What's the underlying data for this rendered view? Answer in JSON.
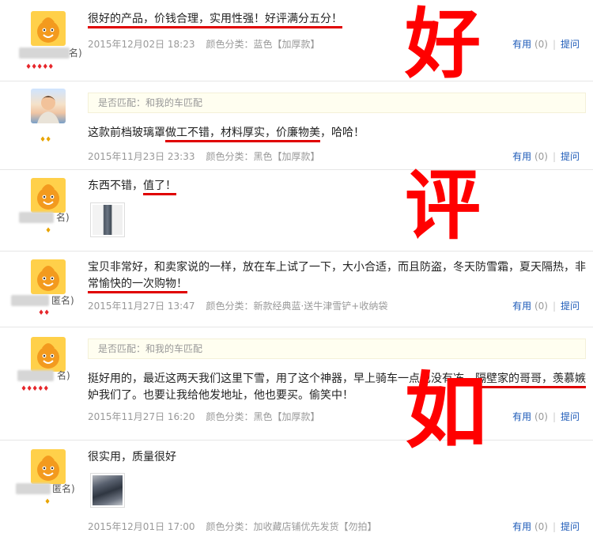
{
  "actions": {
    "useful_label": "有用",
    "useful_count": "(0)",
    "ask_label": "提问"
  },
  "overlay": {
    "c1": "好",
    "c2": "评",
    "c3": "如"
  },
  "reviews": [
    {
      "text_parts": [
        "很好的产品，价钱合理，实用性强！好评满分五分！"
      ],
      "date": "2015年12月02日 18:23",
      "spec": "颜色分类：蓝色【加厚款】",
      "nick_suffix": "名)",
      "gems": "♦♦♦♦♦"
    },
    {
      "match": "是否匹配：和我的车匹配",
      "text_a": "这款前档玻璃罩",
      "text_u1": "做工不错，材料厚实，价廉物美",
      "text_b": "，哈哈！",
      "date": "2015年11月23日 23:33",
      "spec": "颜色分类：黑色【加厚款】",
      "gems": "♦♦"
    },
    {
      "text_a": "东西不错，",
      "text_u1": "值了！",
      "nick_suffix": "名)",
      "gems": "♦"
    },
    {
      "text_a": "宝贝非常好，和卖家说的一样，放在车上试了一下，大小合适，而且防盗，冬天防雪霜，夏天隔热，非",
      "text_u1": "常愉快的一次购物！",
      "date": "2015年11月27日 13:47",
      "spec": "颜色分类：新款经典蓝·送牛津雪铲+收纳袋",
      "nick_suffix": "匿名)",
      "gems": "♦♦"
    },
    {
      "match": "是否匹配：和我的车匹配",
      "text_a": "挺好用的，最近这两天我们这里下雪，用了这个神器，早上骑车一点也没有冻，",
      "text_u1": "隔壁家的哥哥，羡慕嫉",
      "text_b": "妒我们了。也要让我给他发地址，他也要买。偷笑中！",
      "date": "2015年11月27日 16:20",
      "spec": "颜色分类：黑色【加厚款】",
      "nick_suffix": "名)",
      "gems": "♦♦♦♦♦"
    },
    {
      "text_a": "很实用，质量很好",
      "date": "2015年12月01日 17:00",
      "spec": "颜色分类：加收藏店铺优先发货【勿拍】",
      "nick_suffix": "匿名)",
      "gems": "♦"
    }
  ]
}
